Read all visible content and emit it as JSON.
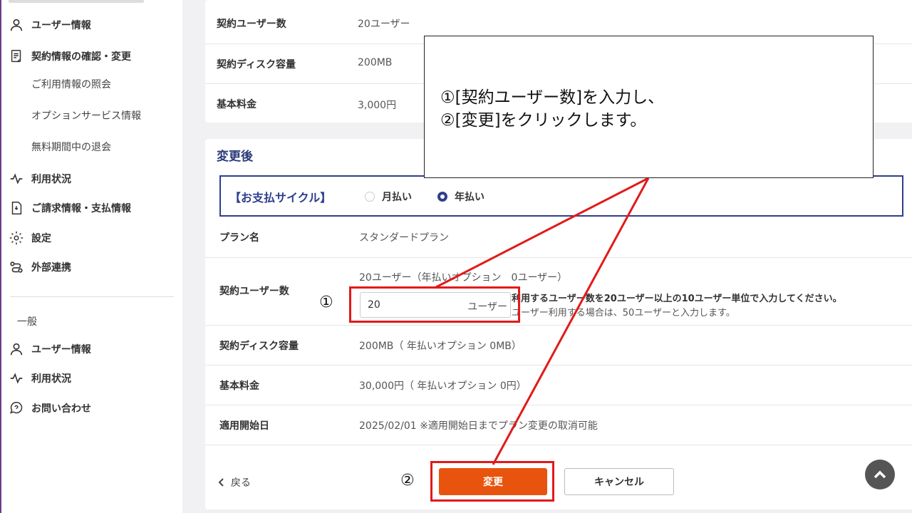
{
  "sidebar": {
    "items": [
      {
        "label": "ユーザー情報",
        "icon": "user-icon"
      },
      {
        "label": "契約情報の確認・変更",
        "icon": "document-icon"
      },
      {
        "label": "利用状況",
        "icon": "activity-icon"
      },
      {
        "label": "ご請求情報・支払情報",
        "icon": "invoice-icon"
      },
      {
        "label": "設定",
        "icon": "gear-icon"
      },
      {
        "label": "外部連携",
        "icon": "integration-icon"
      }
    ],
    "sub_items": [
      "ご利用情報の照会",
      "オプションサービス情報",
      "無料期間中の退会"
    ],
    "section_general": "一般",
    "general_items": [
      {
        "label": "ユーザー情報",
        "icon": "user-icon"
      },
      {
        "label": "利用状況",
        "icon": "activity-icon"
      },
      {
        "label": "お問い合わせ",
        "icon": "help-icon"
      }
    ]
  },
  "current": {
    "rows": [
      {
        "label": "契約ユーザー数",
        "value": "20ユーザー"
      },
      {
        "label": "契約ディスク容量",
        "value": "200MB"
      },
      {
        "label": "基本料金",
        "value": "3,000円"
      }
    ]
  },
  "after": {
    "title": "変更後",
    "payment_cycle": {
      "label": "【お支払サイクル】",
      "options": [
        "月払い",
        "年払い"
      ],
      "selected": "年払い"
    },
    "plan_label": "プラン名",
    "plan_value": "スタンダードプラン",
    "users_label": "契約ユーザー数",
    "users_current": "20ユーザー（年払いオプション　0ユーザー）",
    "users_input_value": "20",
    "users_unit": "ユーザー",
    "users_hint_1": "利用するユーザー数を20ユーザー以上の10ユーザー単位で入力してください。",
    "users_hint_2": "ユーザー利用する場合は、50ユーザーと入力します。",
    "disk_label": "契約ディスク容量",
    "disk_value": "200MB（ 年払いオプション 0MB）",
    "fee_label": "基本料金",
    "fee_value": "30,000円（ 年払いオプション 0円）",
    "start_label": "適用開始日",
    "start_value": "2025/02/01 ※適用開始日までプラン変更の取消可能",
    "back_label": "戻る",
    "change_button": "変更",
    "cancel_button": "キャンセル"
  },
  "annotation": {
    "line1": "①[契約ユーザー数]を入力し、",
    "line2": "②[変更]をクリックします。",
    "marker1": "①",
    "marker2": "②"
  },
  "colors": {
    "accent": "#2f3e8f",
    "primary_button": "#e8540d",
    "highlight": "#e21a1a",
    "sidebar_border": "#6a3d8f"
  }
}
